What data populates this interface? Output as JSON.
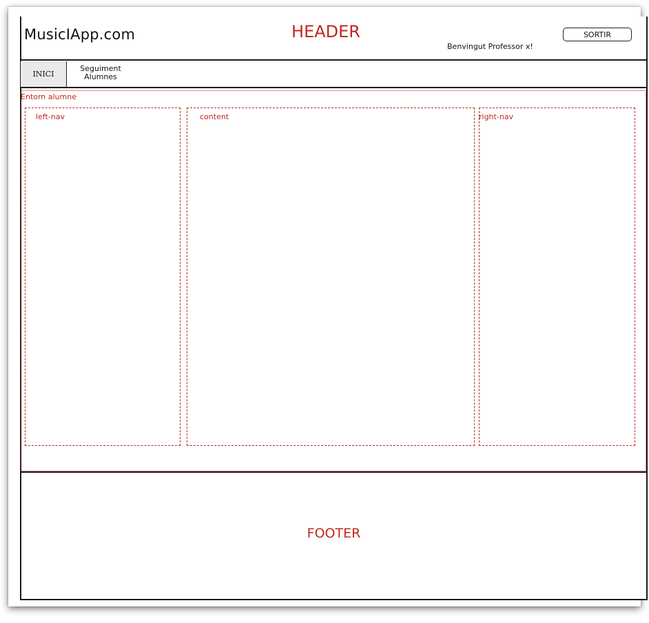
{
  "header": {
    "logo": "MusicIApp.com",
    "label": "HEADER",
    "welcome": "Benvingut Professor x!",
    "logout_label": "SORTIR"
  },
  "nav": {
    "items": [
      {
        "label": "INICI"
      },
      {
        "label_line1": "Seguiment",
        "label_line2": "Alumnes"
      }
    ]
  },
  "main": {
    "environment_label": "Entorn alumne",
    "left_nav_label": "left-nav",
    "content_label": "content",
    "right_nav_label": "right-nav"
  },
  "footer": {
    "label": "FOOTER"
  },
  "colors": {
    "annotation": "#c0271f",
    "border": "#1a1a1a",
    "nav_active_bg": "#e9e9e9"
  }
}
